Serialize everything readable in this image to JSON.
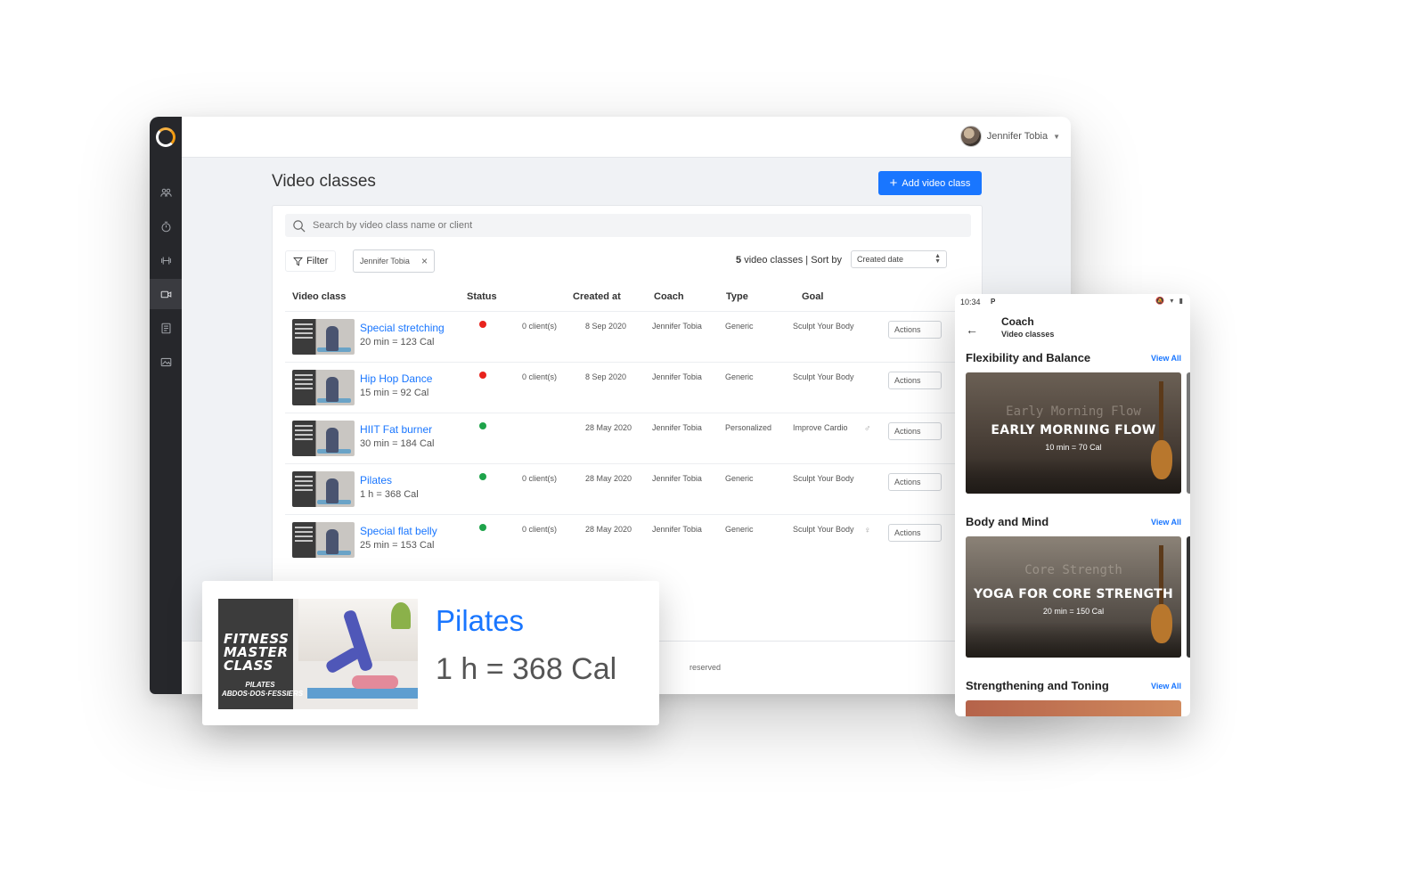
{
  "desktop": {
    "user_name": "Jennifer Tobia",
    "page_title": "Video classes",
    "add_button_label": "Add video class",
    "search_placeholder": "Search by video class name or client",
    "filter_label": "Filter",
    "filter_chip": "Jennifer Tobia",
    "count_number": "5",
    "count_text": "video classes | Sort by",
    "sort_value": "Created date",
    "columns": [
      "Video class",
      "Status",
      "Created at",
      "Coach",
      "Type",
      "Goal"
    ],
    "footer_text": "reserved",
    "rows": [
      {
        "name": "Special stretching",
        "duration": "20 min = 123 Cal",
        "status_color": "#e8231d",
        "clients": "0 client(s)",
        "created": "8 Sep 2020",
        "coach": "Jennifer Tobia",
        "type": "Generic",
        "goal": "Sculpt Your Body",
        "icon": "",
        "action": "Actions"
      },
      {
        "name": "Hip Hop Dance",
        "duration": "15 min = 92 Cal",
        "status_color": "#e8231d",
        "clients": "0 client(s)",
        "created": "8 Sep 2020",
        "coach": "Jennifer Tobia",
        "type": "Generic",
        "goal": "Sculpt Your Body",
        "icon": "",
        "action": "Actions"
      },
      {
        "name": "HIIT Fat burner",
        "duration": "30 min = 184 Cal",
        "status_color": "#1ea34a",
        "clients": "",
        "created": "28 May 2020",
        "coach": "Jennifer Tobia",
        "type": "Personalized",
        "goal": "Improve Cardio",
        "icon": "♂",
        "action": "Actions"
      },
      {
        "name": "Pilates",
        "duration": "1 h = 368 Cal",
        "status_color": "#1ea34a",
        "clients": "0 client(s)",
        "created": "28 May 2020",
        "coach": "Jennifer Tobia",
        "type": "Generic",
        "goal": "Sculpt Your Body",
        "icon": "",
        "action": "Actions"
      },
      {
        "name": "Special flat belly",
        "duration": "25 min = 153 Cal",
        "status_color": "#1ea34a",
        "clients": "0 client(s)",
        "created": "28 May 2020",
        "coach": "Jennifer Tobia",
        "type": "Generic",
        "goal": "Sculpt Your Body",
        "icon": "♀",
        "action": "Actions"
      }
    ]
  },
  "zoom": {
    "thumb_title": "FITNESS MASTER CLASS",
    "thumb_subtitle": "PILATES ABDOS·DOS·FESSIERS",
    "title": "Pilates",
    "duration": "1 h = 368 Cal"
  },
  "phone": {
    "time": "10:34",
    "carrier_glyph": "P",
    "status_icons": "🔕 ▾ ▮",
    "header_title": "Coach",
    "header_subtitle": "Video classes",
    "sections": [
      {
        "title": "Flexibility and Balance",
        "view_all": "View All",
        "ghost": "Early Morning Flow",
        "card_title": "EARLY MORNING FLOW",
        "card_sub": "10 min = 70 Cal"
      },
      {
        "title": "Body and Mind",
        "view_all": "View All",
        "ghost": "Core Strength",
        "card_title": "YOGA FOR CORE STRENGTH",
        "card_sub": "20 min = 150 Cal"
      },
      {
        "title": "Strengthening and Toning",
        "view_all": "View All"
      }
    ]
  },
  "colors": {
    "accent": "#1976ff",
    "status_red": "#e8231d",
    "status_green": "#1ea34a",
    "sidebar": "#26272b"
  }
}
